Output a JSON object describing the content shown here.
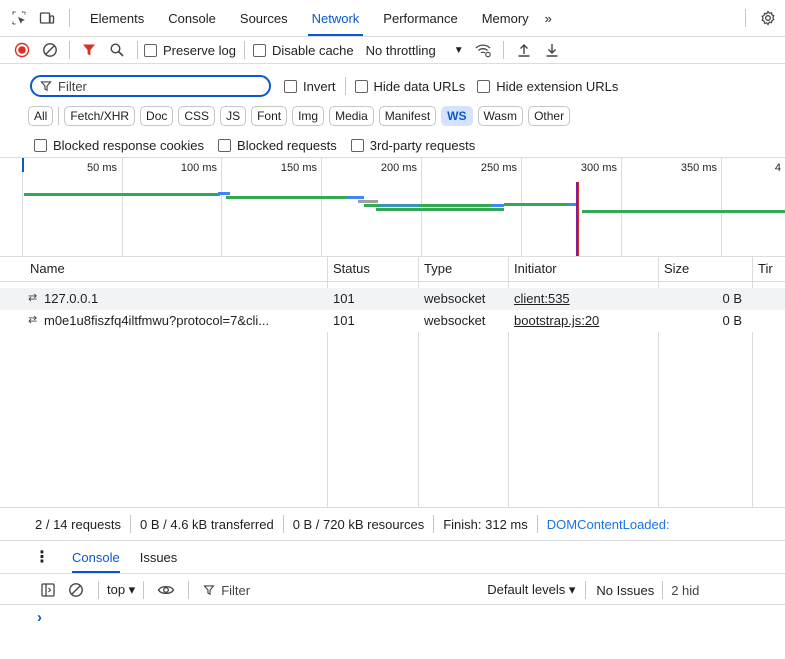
{
  "top_tabs": [
    "Elements",
    "Console",
    "Sources",
    "Network",
    "Performance",
    "Memory"
  ],
  "more_tabs": "»",
  "toolbar": {
    "preserve_log": "Preserve log",
    "disable_cache": "Disable cache",
    "throttling": "No throttling"
  },
  "filter": {
    "placeholder": "Filter",
    "invert": "Invert",
    "hide_data_urls": "Hide data URLs",
    "hide_extension_urls": "Hide extension URLs"
  },
  "type_chips": [
    "All",
    "Fetch/XHR",
    "Doc",
    "CSS",
    "JS",
    "Font",
    "Img",
    "Media",
    "Manifest",
    "WS",
    "Wasm",
    "Other"
  ],
  "active_chip": "WS",
  "blocked": {
    "cookies": "Blocked response cookies",
    "requests": "Blocked requests",
    "third_party": "3rd-party requests"
  },
  "timeline_ticks": [
    "50 ms",
    "100 ms",
    "150 ms",
    "200 ms",
    "250 ms",
    "300 ms",
    "350 ms",
    "4"
  ],
  "table": {
    "headers": [
      "Name",
      "Status",
      "Type",
      "Initiator",
      "Size",
      "Tir"
    ],
    "rows": [
      {
        "name": "127.0.0.1",
        "status": "101",
        "type": "websocket",
        "initiator": "client:535",
        "size": "0 B"
      },
      {
        "name": "m0e1u8fiszfq4iltfmwu?protocol=7&cli...",
        "status": "101",
        "type": "websocket",
        "initiator": "bootstrap.js:20",
        "size": "0 B"
      }
    ]
  },
  "status_bar": {
    "requests": "2 / 14 requests",
    "transferred": "0 B / 4.6 kB transferred",
    "resources": "0 B / 720 kB resources",
    "finish": "Finish: 312 ms",
    "dcl": "DOMContentLoaded:"
  },
  "drawer": {
    "tabs": [
      "Console",
      "Issues"
    ],
    "context": "top ▾",
    "filter_placeholder": "Filter",
    "levels": "Default levels ▾",
    "issues": "No Issues",
    "hidden": "2 hid",
    "prompt": "›"
  },
  "colors": {
    "accent": "#0b57d0",
    "record": "#d93025",
    "green": "#34a853",
    "blue": "#4285f4",
    "purple": "#7b1fa2"
  }
}
